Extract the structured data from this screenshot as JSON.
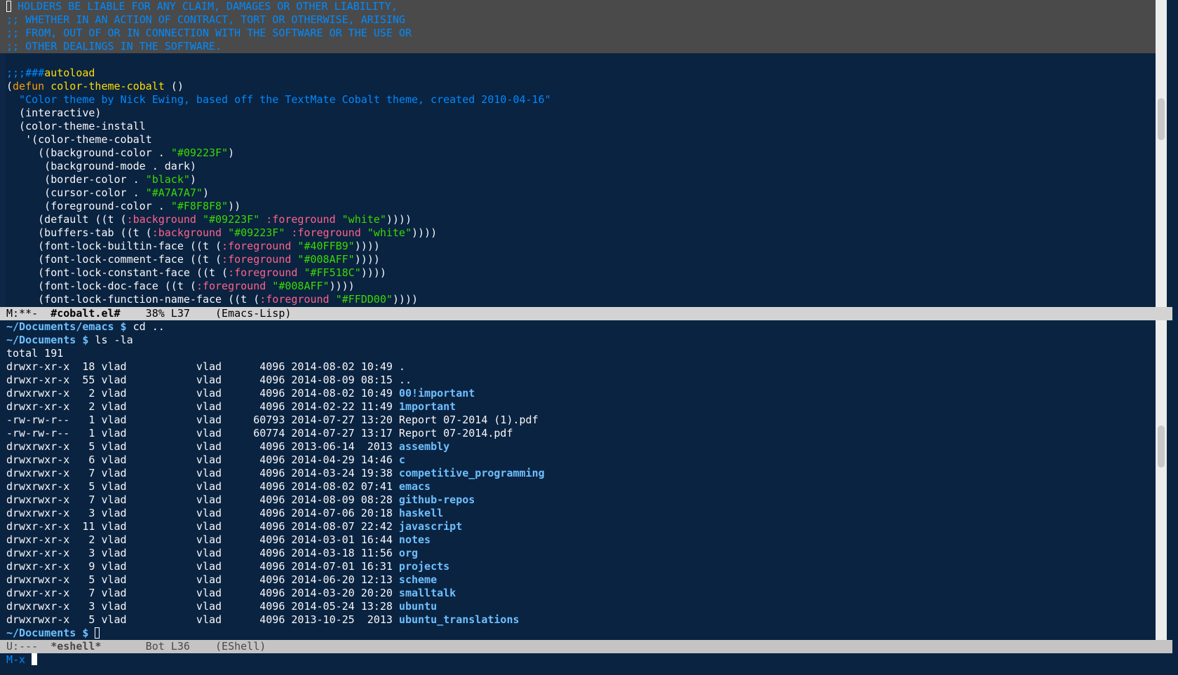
{
  "colors": {
    "background": "#0a2341",
    "comment": "#008aff",
    "keyword": "#ff9d00",
    "function": "#ffdd00",
    "string": "#3ad900",
    "directory": "#6ec0ff"
  },
  "editor": {
    "license_lines": [
      " HOLDERS BE LIABLE FOR ANY CLAIM, DAMAGES OR OTHER LIABILITY,",
      ";; WHETHER IN AN ACTION OF CONTRACT, TORT OR OTHERWISE, ARISING",
      ";; FROM, OUT OF OR IN CONNECTION WITH THE SOFTWARE OR THE USE OR",
      ";; OTHER DEALINGS IN THE SOFTWARE."
    ],
    "autoload_comment": ";;;###",
    "autoload_word": "autoload",
    "defun_open": "(",
    "defun_kw": "defun",
    "defun_name": "color-theme-cobalt",
    "defun_args": " ()",
    "docstring": "  \"Color theme by Nick Ewing, based off the TextMate Cobalt theme, created 2010-04-16\"",
    "interactive": "  (interactive)",
    "install": "  (color-theme-install",
    "theme_sym": "   '(color-theme-cobalt",
    "bg_color_pre": "     ((background-color . ",
    "bg_color_val": "\"#09223F\"",
    "bg_color_post": ")",
    "bg_mode": "      (background-mode . dark)",
    "border_pre": "      (border-color . ",
    "border_val": "\"black\"",
    "border_post": ")",
    "cursor_pre": "      (cursor-color . ",
    "cursor_val": "\"#A7A7A7\"",
    "cursor_post": ")",
    "fg_pre": "      (foreground-color . ",
    "fg_val": "\"#F8F8F8\"",
    "fg_post": "))",
    "default_pre": "     (default ((t (",
    "default_bg_kw": ":background",
    "default_bg_val": " \"#09223F\"",
    "default_fg_kw": " :foreground",
    "default_fg_val": " \"white\"",
    "default_post": "))))",
    "buffers_pre": "     (buffers-tab ((t (",
    "buffers_bg_kw": ":background",
    "buffers_bg_val": " \"#09223F\"",
    "buffers_fg_kw": " :foreground",
    "buffers_fg_val": " \"white\"",
    "buffers_post": "))))",
    "builtin_pre": "     (font-lock-builtin-face ((t (",
    "builtin_kw": ":foreground",
    "builtin_val": " \"#40FFB9\"",
    "builtin_post": "))))",
    "comment_pre": "     (font-lock-comment-face ((t (",
    "comment_kw": ":foreground",
    "comment_val": " \"#008AFF\"",
    "comment_post": "))))",
    "constant_pre": "     (font-lock-constant-face ((t (",
    "constant_kw": ":foreground",
    "constant_val": " \"#FF518C\"",
    "constant_post": "))))",
    "doc_pre": "     (font-lock-doc-face ((t (",
    "doc_kw": ":foreground",
    "doc_val": " \"#008AFF\"",
    "doc_post": "))))",
    "fnname_pre": "     (font-lock-function-name-face ((t (",
    "fnname_kw": ":foreground",
    "fnname_val": " \"#FFDD00\"",
    "fnname_post": "))))"
  },
  "modeline_top": {
    "status": "M:**-  ",
    "buffer": "#cobalt.el#",
    "position": "    38% L37    ",
    "mode": "(Emacs-Lisp)"
  },
  "shell": {
    "cmd1_prompt": "~/Documents/emacs $",
    "cmd1_text": " cd ..",
    "cmd2_prompt": "~/Documents $",
    "cmd2_text": " ls -la",
    "total": "total 191",
    "entries": [
      {
        "meta": "drwxr-xr-x  18 vlad           vlad      4096 2014-08-02 10:49 ",
        "name": ".",
        "dir": false
      },
      {
        "meta": "drwxr-xr-x  55 vlad           vlad      4096 2014-08-09 08:15 ",
        "name": "..",
        "dir": false
      },
      {
        "meta": "drwxrwxr-x   2 vlad           vlad      4096 2014-08-02 10:49 ",
        "name": "00!important",
        "dir": true
      },
      {
        "meta": "drwxr-xr-x   2 vlad           vlad      4096 2014-02-22 11:49 ",
        "name": "1mportant",
        "dir": true
      },
      {
        "meta": "-rw-rw-r--   1 vlad           vlad     60793 2014-07-27 13:20 ",
        "name": "Report 07-2014 (1).pdf",
        "dir": false
      },
      {
        "meta": "-rw-rw-r--   1 vlad           vlad     60774 2014-07-27 13:17 ",
        "name": "Report 07-2014.pdf",
        "dir": false
      },
      {
        "meta": "drwxrwxr-x   5 vlad           vlad      4096 2013-06-14  2013 ",
        "name": "assembly",
        "dir": true
      },
      {
        "meta": "drwxrwxr-x   6 vlad           vlad      4096 2014-04-29 14:46 ",
        "name": "c",
        "dir": true
      },
      {
        "meta": "drwxrwxr-x   7 vlad           vlad      4096 2014-03-24 19:38 ",
        "name": "competitive_programming",
        "dir": true
      },
      {
        "meta": "drwxrwxr-x   5 vlad           vlad      4096 2014-08-02 07:41 ",
        "name": "emacs",
        "dir": true
      },
      {
        "meta": "drwxrwxr-x   7 vlad           vlad      4096 2014-08-09 08:28 ",
        "name": "github-repos",
        "dir": true
      },
      {
        "meta": "drwxrwxr-x   3 vlad           vlad      4096 2014-07-06 20:18 ",
        "name": "haskell",
        "dir": true
      },
      {
        "meta": "drwxr-xr-x  11 vlad           vlad      4096 2014-08-07 22:42 ",
        "name": "javascript",
        "dir": true
      },
      {
        "meta": "drwxr-xr-x   2 vlad           vlad      4096 2014-03-01 16:44 ",
        "name": "notes",
        "dir": true
      },
      {
        "meta": "drwxr-xr-x   3 vlad           vlad      4096 2014-03-18 11:56 ",
        "name": "org",
        "dir": true
      },
      {
        "meta": "drwxr-xr-x   9 vlad           vlad      4096 2014-07-01 16:31 ",
        "name": "projects",
        "dir": true
      },
      {
        "meta": "drwxrwxr-x   5 vlad           vlad      4096 2014-06-20 12:13 ",
        "name": "scheme",
        "dir": true
      },
      {
        "meta": "drwxr-xr-x   7 vlad           vlad      4096 2014-03-20 20:20 ",
        "name": "smalltalk",
        "dir": true
      },
      {
        "meta": "drwxrwxr-x   3 vlad           vlad      4096 2014-05-24 13:28 ",
        "name": "ubuntu",
        "dir": true
      },
      {
        "meta": "drwxrwxr-x   5 vlad           vlad      4096 2013-10-25  2013 ",
        "name": "ubuntu_translations",
        "dir": true
      }
    ],
    "final_prompt": "~/Documents $"
  },
  "modeline_bottom": {
    "status": "U:---  ",
    "buffer": "*eshell*",
    "position": "       Bot L36    ",
    "mode": "(EShell)"
  },
  "minibuffer": {
    "prompt": "M-x"
  }
}
